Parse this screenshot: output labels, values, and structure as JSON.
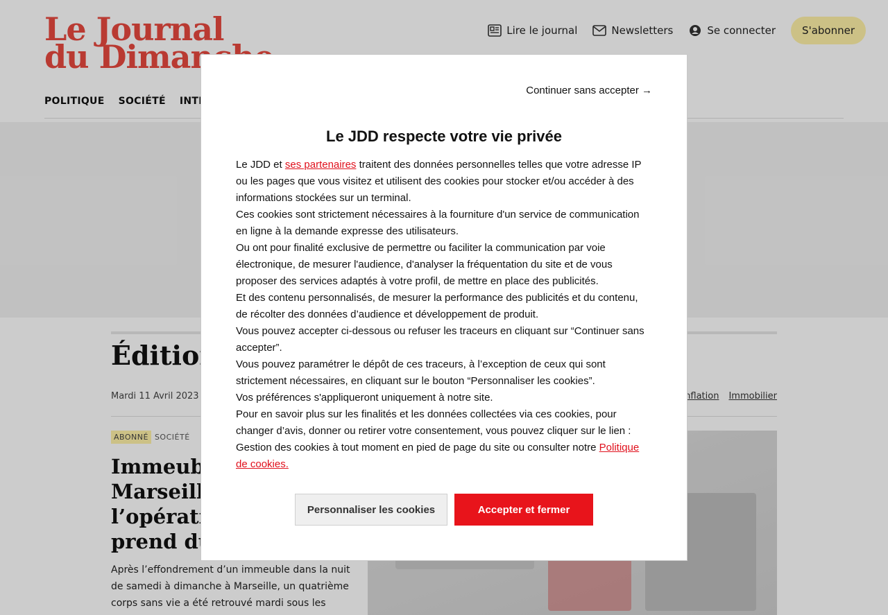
{
  "header": {
    "logo_line1": "Le Journal",
    "logo_line2": "du Dimanche",
    "links": [
      {
        "label": "Lire le journal",
        "icon": "newspaper-icon"
      },
      {
        "label": "Newsletters",
        "icon": "mail-icon"
      },
      {
        "label": "Se connecter",
        "icon": "user-icon"
      }
    ],
    "subscribe_label": "S'abonner"
  },
  "nav": {
    "items": [
      "POLITIQUE",
      "SOCIÉTÉ",
      "INTERNATIONAL"
    ]
  },
  "edition": {
    "title": "Édition",
    "date": "Mardi 11 Avril 2023",
    "tags": [
      "Inflation",
      "Immobilier"
    ]
  },
  "article": {
    "badge": "ABONNÉ",
    "category": "SOCIÉTÉ",
    "title_lines": [
      "Immeuble effondré à",
      "Marseille : comment",
      "l’opération",
      "prend du temps"
    ],
    "lede_lines": [
      "Après l’effondrement d’un immeuble dans la nuit",
      "de samedi à dimanche à Marseille, un quatrième",
      "corps sans vie a été retrouvé mardi sous les"
    ]
  },
  "consent": {
    "continue_label": "Continuer sans accepter →",
    "title": "Le JDD respecte votre vie privée",
    "intro_before": "Le JDD et ",
    "partners_link": "ses partenaires",
    "intro_after": " traitent des données personnelles telles que votre adresse IP",
    "lines": [
      "ou les pages que vous visitez et utilisent des cookies pour stocker et/ou accéder à des",
      "informations stockées sur un terminal.",
      "Ces cookies sont strictement nécessaires à la fourniture d'un service de communication",
      "en ligne à la demande expresse des utilisateurs.",
      "Ou ont pour finalité exclusive de permettre ou faciliter la communication par voie",
      "électronique, de mesurer l'audience, d'analyser la fréquentation du site et de vous",
      "proposer des services adaptés à votre profil, de mettre en place des publicités.",
      "Et des contenu personnalisés, de mesurer la performance des publicités et du contenu,",
      "de récolter des données d’audience et développement de produit.",
      "Vous pouvez accepter ci-dessous ou refuser les traceurs en cliquant sur “Continuer sans",
      "accepter”.",
      "Vous pouvez paramétrer le dépôt de ces traceurs, à l’exception de ceux qui sont",
      "strictement nécessaires, en cliquant sur le bouton “Personnaliser les cookies”.",
      "Vos préférences s'appliqueront uniquement à notre site.",
      "Pour en savoir plus sur les finalités et les données collectées via ces cookies, pour",
      "changer d’avis, donner ou retirer votre consentement, vous pouvez cliquer sur le lien :"
    ],
    "last_line_before": "Gestion des cookies à tout moment en pied de page du site ou consulter notre ",
    "policy_link_part1": "Politique",
    "policy_link_part2": "de cookies.",
    "customize_label": "Personnaliser les cookies",
    "accept_label": "Accepter et fermer"
  },
  "colors": {
    "brand_red": "#e8493f",
    "accept_red": "#e8141b",
    "subscribe_yellow": "#fff2a8"
  }
}
